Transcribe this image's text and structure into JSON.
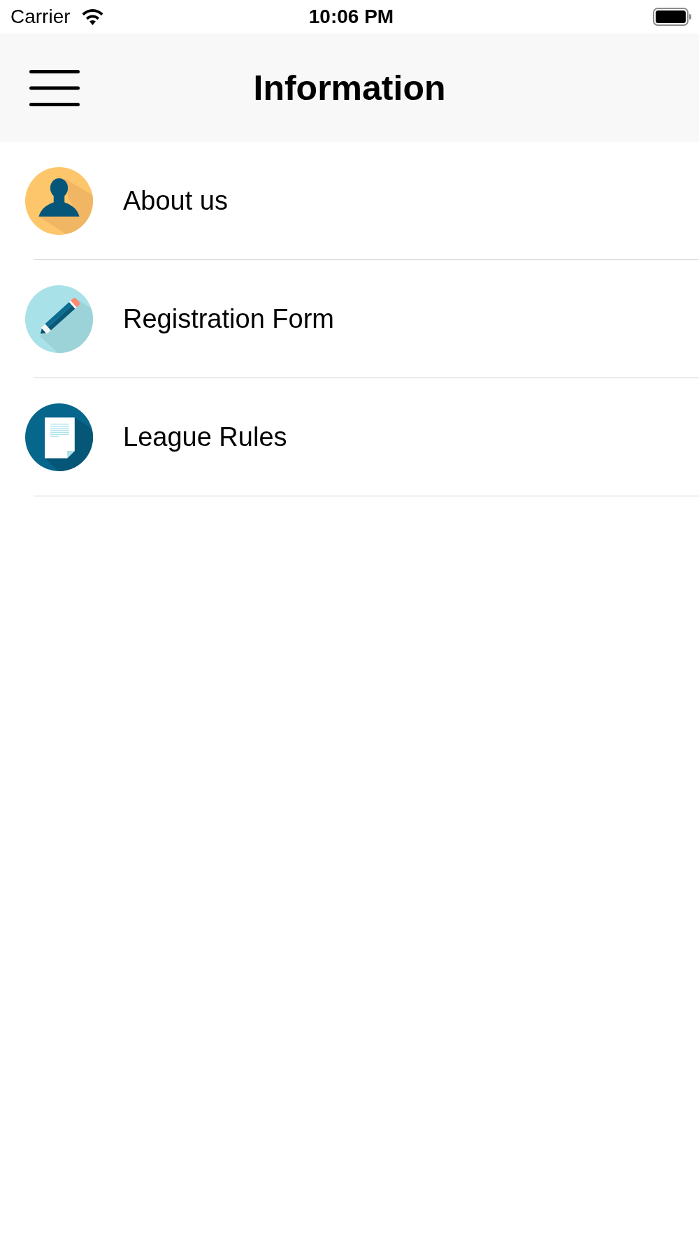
{
  "status_bar": {
    "carrier": "Carrier",
    "time": "10:06 PM"
  },
  "nav_bar": {
    "title": "Information"
  },
  "items": [
    {
      "label": "About us"
    },
    {
      "label": "Registration Form"
    },
    {
      "label": "League Rules"
    }
  ]
}
